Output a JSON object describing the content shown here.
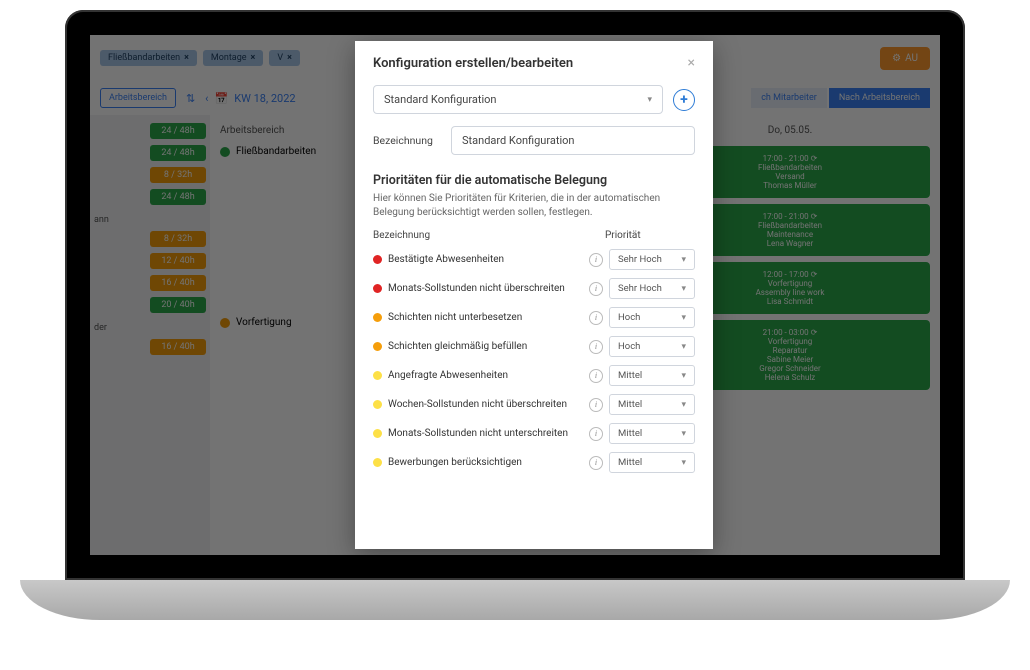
{
  "bg": {
    "chips": [
      "Fließbandarbeiten",
      "Montage",
      "V"
    ],
    "auto_btn": "AU",
    "area_btn": "Arbeitsbereich",
    "week": "KW 18, 2022",
    "tabs": {
      "t1": "ch Mitarbeiter",
      "t2": "Nach Arbeitsbereich"
    },
    "side_badges": [
      "24 / 48h",
      "24 / 48h",
      "8 / 32h",
      "24 / 48h",
      "8 / 32h",
      "12 / 40h",
      "16 / 40h",
      "20 / 40h",
      "16 / 40h"
    ],
    "area_header": "Arbeitsbereich",
    "areas": [
      "Fließbandarbeiten",
      "Vorfertigung"
    ],
    "day_header": "Do, 05.05.",
    "cards": [
      {
        "time": "17:00 - 21:00",
        "l1": "Fließbandarbeiten",
        "l2": "Versand",
        "l3": "Thomas Müller"
      },
      {
        "time": "17:00 - 21:00",
        "l1": "Fließbandarbeiten",
        "l2": "Maintenance",
        "l3": "Lena Wagner"
      },
      {
        "time": "12:00 - 17:00",
        "l1": "Vorfertigung",
        "l2": "Assembly line work",
        "l3": "Lisa Schmidt"
      },
      {
        "time": "21:00 - 03:00",
        "l1": "Vorfertigung",
        "l2": "Reparatur",
        "l3": "Sabine Meier",
        "l4": "Gregor Schneider",
        "l5": "Helena Schulz"
      }
    ]
  },
  "modal": {
    "title": "Konfiguration erstellen/bearbeiten",
    "config_selected": "Standard Konfiguration",
    "name_label": "Bezeichnung",
    "name_value": "Standard Konfiguration",
    "section_title": "Prioritäten für die automatische Belegung",
    "section_desc": "Hier können Sie Prioritäten für Kriterien, die in der automatischen Belegung berücksichtigt werden sollen, festlegen.",
    "col1": "Bezeichnung",
    "col2": "Priorität",
    "rows": [
      {
        "color": "red",
        "name": "Bestätigte Abwesenheiten",
        "prio": "Sehr Hoch"
      },
      {
        "color": "red",
        "name": "Monats-Sollstunden nicht überschreiten",
        "prio": "Sehr Hoch"
      },
      {
        "color": "orange",
        "name": "Schichten nicht unterbesetzen",
        "prio": "Hoch"
      },
      {
        "color": "orange",
        "name": "Schichten gleichmäßig befüllen",
        "prio": "Hoch"
      },
      {
        "color": "yellow",
        "name": "Angefragte Abwesenheiten",
        "prio": "Mittel"
      },
      {
        "color": "yellow",
        "name": "Wochen-Sollstunden nicht überschreiten",
        "prio": "Mittel"
      },
      {
        "color": "yellow",
        "name": "Monats-Sollstunden nicht unterschreiten",
        "prio": "Mittel"
      },
      {
        "color": "yellow",
        "name": "Bewerbungen berücksichtigen",
        "prio": "Mittel"
      }
    ]
  }
}
